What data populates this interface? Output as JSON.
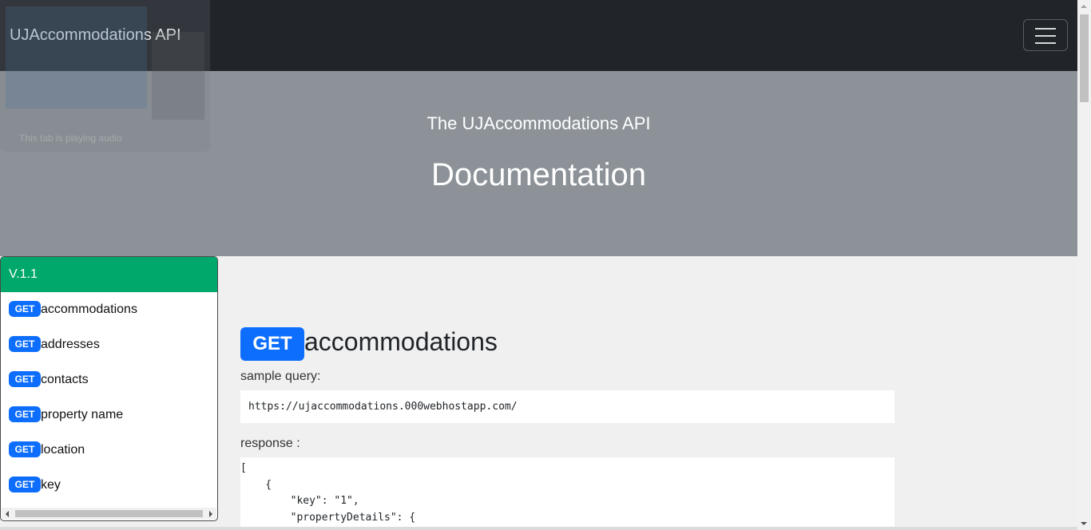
{
  "navbar": {
    "brand": "UJAccommodations API",
    "toggler_icon": "hamburger-menu-icon"
  },
  "browser_overlay": {
    "audio_text": "This tab is playing audio"
  },
  "hero": {
    "subtitle": "The UJAccommodations API",
    "title": "Documentation"
  },
  "sidebar": {
    "version": "V.1.1",
    "items": [
      {
        "method": "GET",
        "label": "accommodations"
      },
      {
        "method": "GET",
        "label": "addresses"
      },
      {
        "method": "GET",
        "label": "contacts"
      },
      {
        "method": "GET",
        "label": "property name"
      },
      {
        "method": "GET",
        "label": "location"
      },
      {
        "method": "GET",
        "label": "key"
      }
    ]
  },
  "main": {
    "method": "GET",
    "endpoint": "accommodations",
    "sample_query_label": "sample query:",
    "sample_query": "https://ujaccommodations.000webhostapp.com/",
    "response_label": "response :",
    "response_code": "[\n    {\n        \"key\": \"1\",\n        \"propertyDetails\": {"
  },
  "colors": {
    "navbar": "#212529",
    "hero": "#8c9298",
    "sidebar_header": "#00a86b",
    "badge": "#0d6efd",
    "page_bg": "#f0f0f0"
  }
}
